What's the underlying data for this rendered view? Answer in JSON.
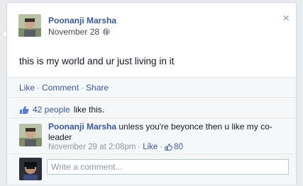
{
  "post": {
    "author": "Poonanji Marsha",
    "date": "November 28",
    "text": "this is my world and ur just living in it"
  },
  "actions": {
    "like": "Like",
    "comment": "Comment",
    "share": "Share",
    "separator": "·"
  },
  "likes": {
    "count_text": "42 people",
    "suffix": "like this."
  },
  "comment": {
    "author": "Poonanji Marsha",
    "text": "unless you're beyonce then u like my co-leader",
    "timestamp": "November 29 at 2:08pm",
    "like_label": "Like",
    "like_count": "80"
  },
  "composer": {
    "placeholder": "Write a comment..."
  },
  "close_label": "×",
  "colors": {
    "link": "#3b5998",
    "muted": "#9197a3",
    "card_background": "#ffffff",
    "footer_background": "#f6f7f9"
  },
  "icons": [
    "globe-icon",
    "close-icon",
    "thumbs-up-icon"
  ]
}
